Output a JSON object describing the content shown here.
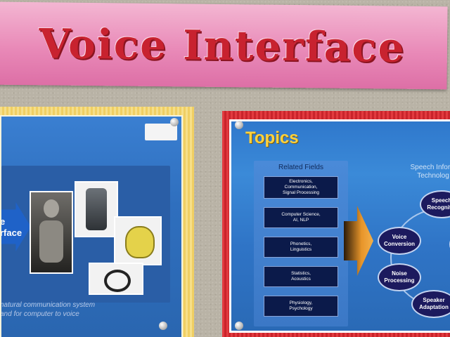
{
  "banner": {
    "title": "Voice Interface"
  },
  "left_poster": {
    "arrow_text": "e\nrface",
    "caption_line1": "natural communication system",
    "caption_line2": "and for computer to voice"
  },
  "right_poster": {
    "title": "Topics",
    "related_fields": {
      "heading": "Related Fields",
      "items": [
        "Electronics,\nCommunication,\nSignal Processing",
        "Computer Science,\nAI, NLP",
        "Phonetics,\nLinguistics",
        "Statistics,\nAcoustics",
        "Physiology,\nPsychology"
      ]
    },
    "speech_info": {
      "heading": "Speech Inform\nTechnolog",
      "nodes": [
        "Speech\nRecognitio",
        "Voice\nConversion",
        "Noise\nProcessing",
        "Speaker\nAdaptation"
      ]
    }
  }
}
